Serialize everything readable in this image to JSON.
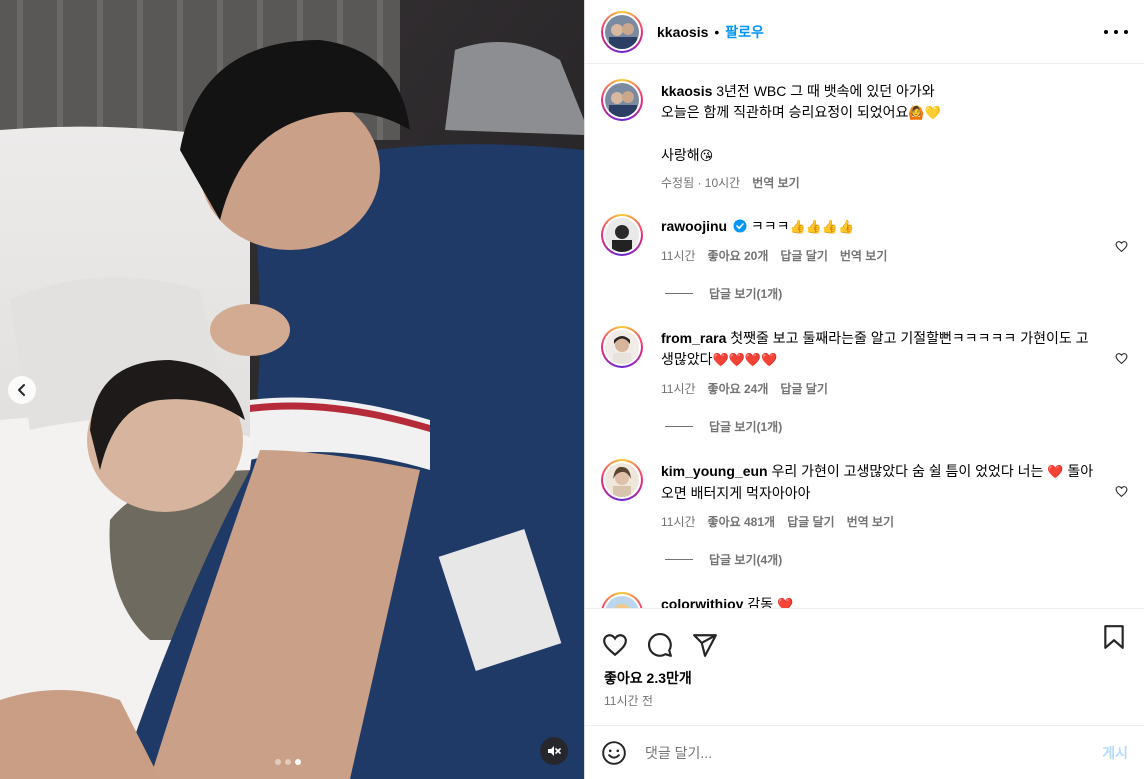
{
  "post": {
    "username": "kkaosis",
    "separator": "•",
    "follow_label": "팔로우",
    "caption_line1": "3년전 WBC 그 때 뱃속에 있던 아가와",
    "caption_line2": "오늘은 함께 직관하며 승리요정이 되었어요",
    "caption_line2_emoji": "🙆💛",
    "caption_line3": "사랑해",
    "caption_line3_emoji": "😘",
    "caption_meta_edited": "수정됨 · 10시간",
    "caption_translate": "번역 보기"
  },
  "comments": [
    {
      "username": "rawoojinu",
      "verified": true,
      "text": "ㅋㅋㅋ",
      "emoji": "👍👍👍👍",
      "time": "11시간",
      "likes": "좋아요 20개",
      "reply": "답글 달기",
      "translate": "번역 보기",
      "replies": "답글 보기(1개)"
    },
    {
      "username": "from_rara",
      "text": "첫쨋줄 보고 둘째라는줄 알고 기절할뻔ㅋㅋㅋㅋㅋ 가현이도 고생많았다",
      "emoji": "❤️❤️❤️❤️",
      "time": "11시간",
      "likes": "좋아요 24개",
      "reply": "답글 달기",
      "replies": "답글 보기(1개)"
    },
    {
      "username": "kim_young_eun",
      "text": "우리 가현이 고생많았다 숨 쉴 틈이 었었다 너는",
      "emoji": "❤️",
      "text2": "돌아오면 배터지게 먹자아아아",
      "time": "11시간",
      "likes": "좋아요 481개",
      "reply": "답글 달기",
      "translate": "번역 보기",
      "replies": "답글 보기(4개)"
    },
    {
      "username": "colorwithjoy",
      "text": "감동",
      "emoji": "❤️"
    }
  ],
  "footer": {
    "likes": "좋아요 2.3만개",
    "time": "11시간 전",
    "comment_placeholder": "댓글 달기...",
    "post_label": "게시"
  },
  "media": {
    "carousel_count": 3,
    "carousel_active": 3
  },
  "icons": [
    "chevron-left-icon",
    "mute-icon",
    "more-icon",
    "heart-icon",
    "comment-icon",
    "share-icon",
    "bookmark-icon",
    "emoji-icon",
    "verified-icon"
  ],
  "colors": {
    "follow": "#0095f6",
    "muted_text": "#737373",
    "post_disabled": "#b3dbff",
    "heart_red": "#ed4956"
  }
}
